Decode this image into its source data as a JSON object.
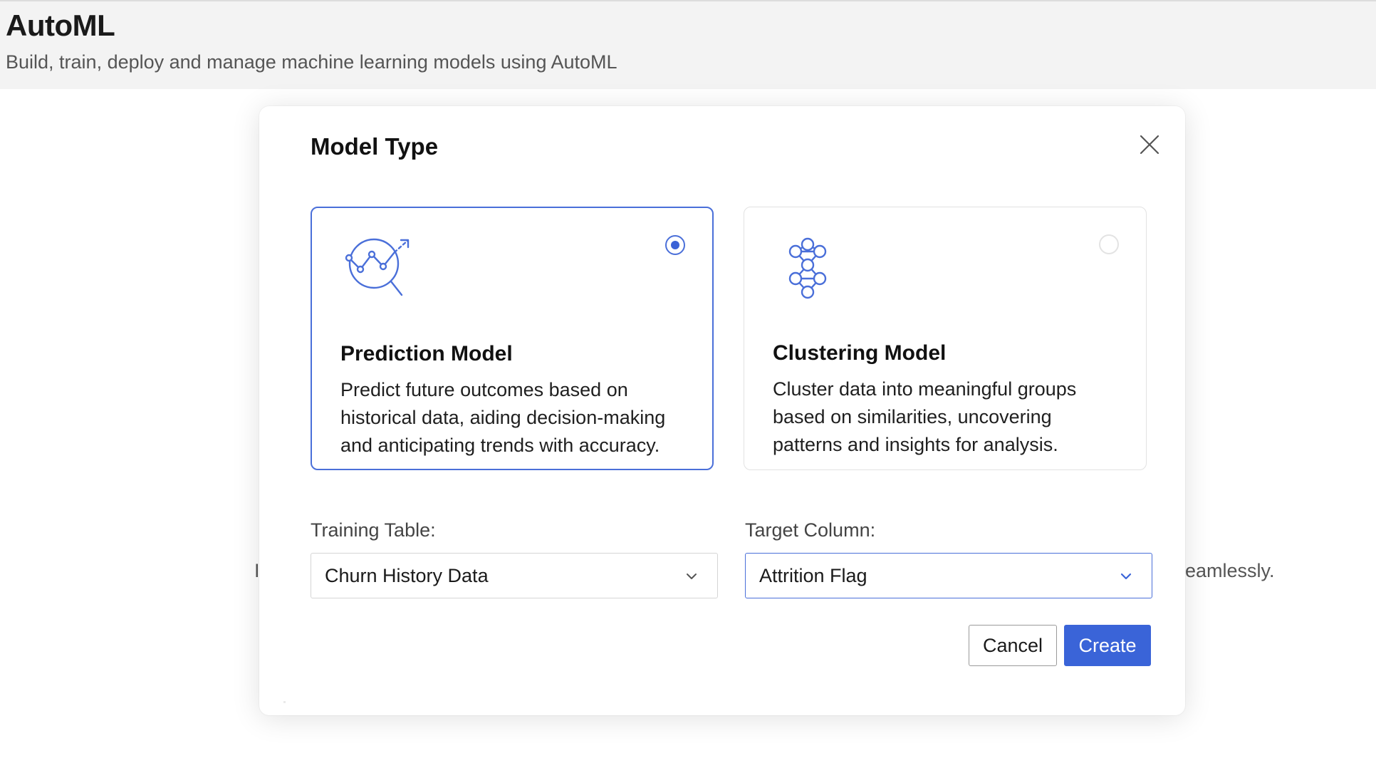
{
  "app": {
    "title": "AutoML",
    "subtitle": "Build, train, deploy and manage machine learning models using AutoML"
  },
  "background": {
    "fragment_left": "I",
    "fragment_right": "eamlessly."
  },
  "modal": {
    "title": "Model Type",
    "close_icon": "close-icon",
    "cards": [
      {
        "title": "Prediction Model",
        "description": "Predict future outcomes based on historical data, aiding decision-making and anticipating trends with accuracy.",
        "icon": "prediction-analytics-icon",
        "selected": true
      },
      {
        "title": "Clustering Model",
        "description": "Cluster data into meaningful groups based on similarities, uncovering patterns and insights for analysis.",
        "icon": "clustering-network-icon",
        "selected": false
      }
    ],
    "fields": {
      "training_table": {
        "label": "Training Table:",
        "value": "Churn History Data"
      },
      "target_column": {
        "label": "Target Column:",
        "value": "Attrition Flag"
      }
    },
    "buttons": {
      "cancel": "Cancel",
      "create": "Create"
    }
  },
  "colors": {
    "accent": "#3a64d8",
    "header_bg": "#f3f3f3",
    "selected_border": "#4a6fd9"
  }
}
